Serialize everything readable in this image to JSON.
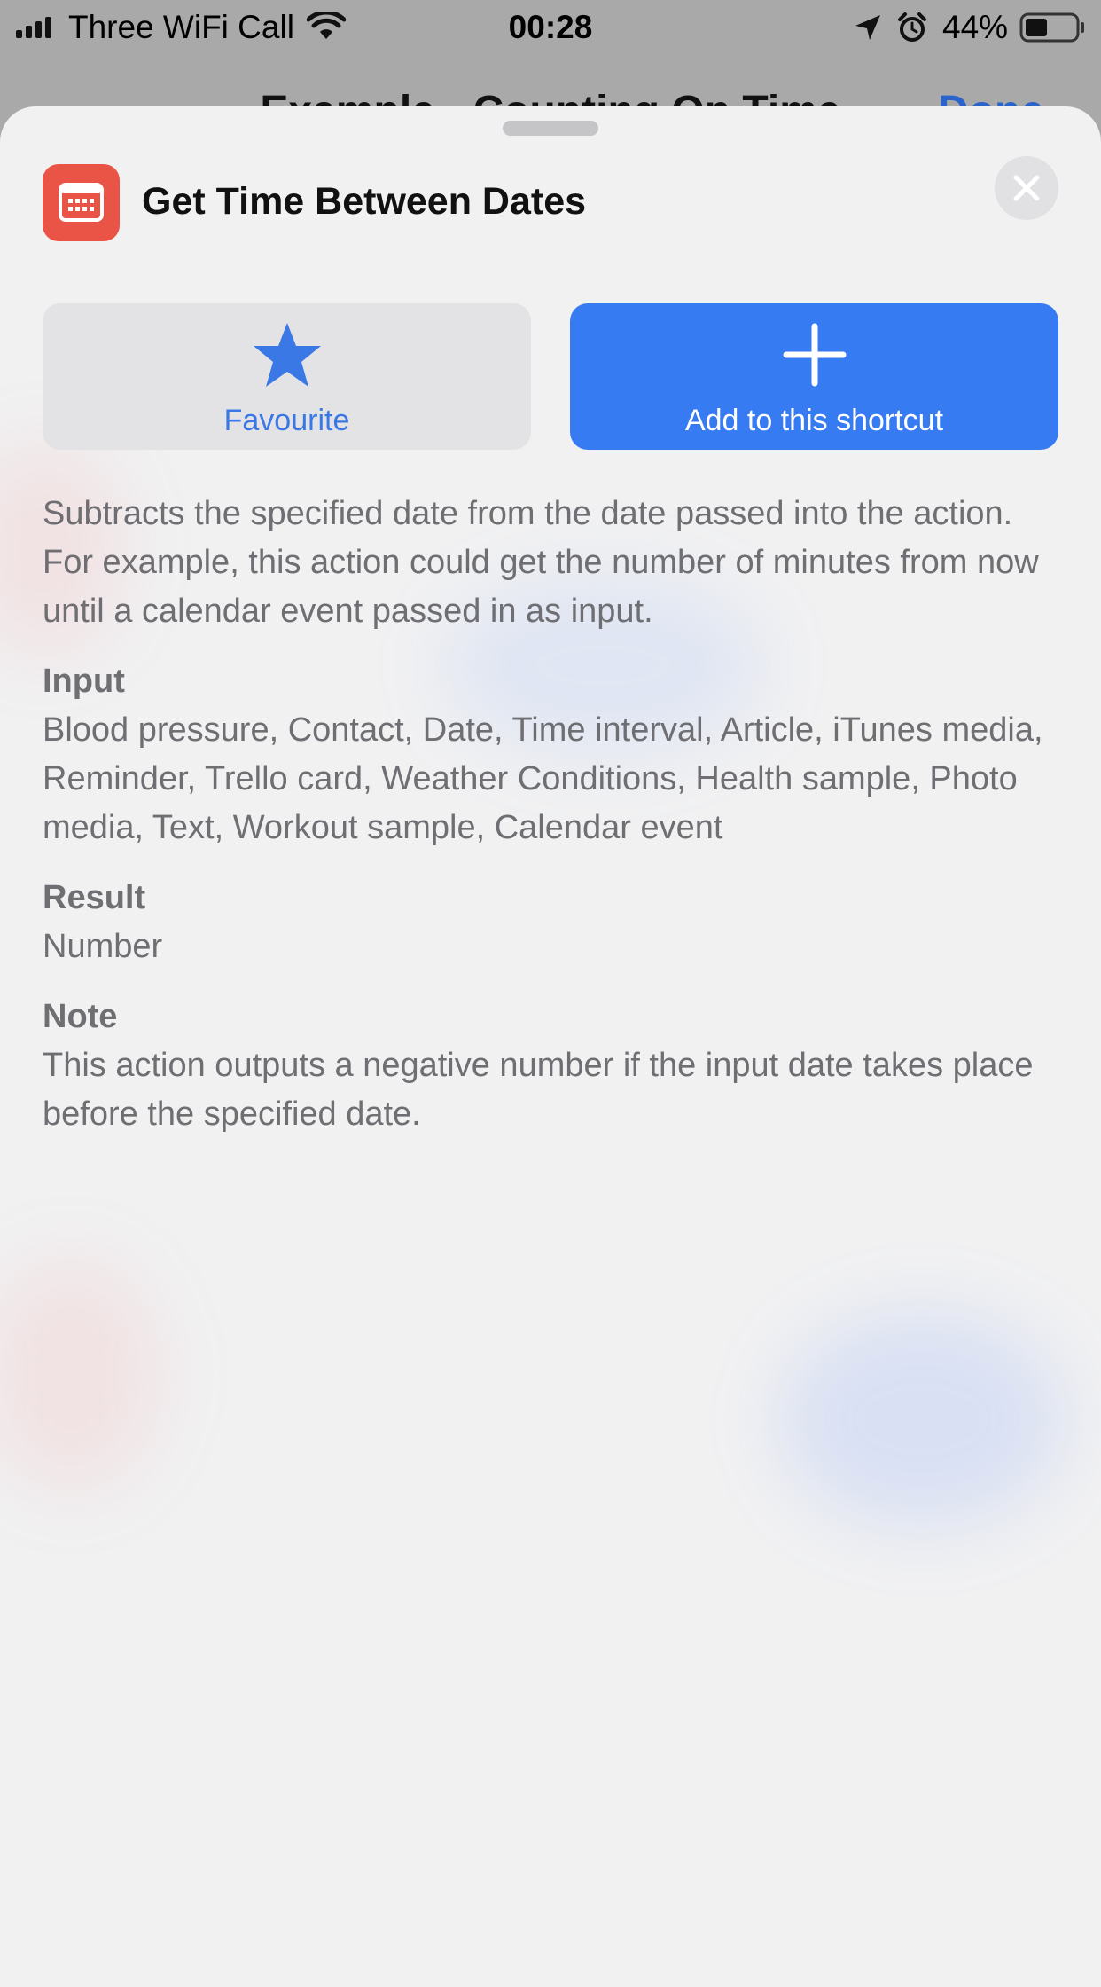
{
  "status_bar": {
    "carrier": "Three WiFi Call",
    "time": "00:28",
    "battery_percent": "44%",
    "battery_level": 0.44,
    "icons": [
      "signal-icon",
      "wifi-icon",
      "location-icon",
      "alarm-icon",
      "battery-icon"
    ]
  },
  "background_nav": {
    "title": "Example - Counting On Time",
    "done_label": "Done"
  },
  "sheet": {
    "app_icon": "calendar-icon",
    "title": "Get Time Between Dates",
    "close_icon": "close-icon",
    "favourite": {
      "icon": "star-icon",
      "label": "Favourite"
    },
    "add": {
      "icon": "plus-icon",
      "label": "Add to this shortcut"
    },
    "description": "Subtracts the specified date from the date passed into the action. For example, this action could get the number of minutes from now until a calendar event passed in as input.",
    "input": {
      "heading": "Input",
      "text": "Blood pressure, Contact, Date, Time interval, Article, iTunes media, Reminder, Trello card, Weather Conditions, Health sample, Photo media, Text, Workout sample, Calendar event"
    },
    "result": {
      "heading": "Result",
      "text": "Number"
    },
    "note": {
      "heading": "Note",
      "text": "This action outputs a negative number if the input date takes place before the specified date."
    }
  },
  "colors": {
    "accent": "#377bf2",
    "app_icon": "#ea5446",
    "secondary_text": "#6e6e73",
    "sheet_background": "#f1f1f2"
  }
}
